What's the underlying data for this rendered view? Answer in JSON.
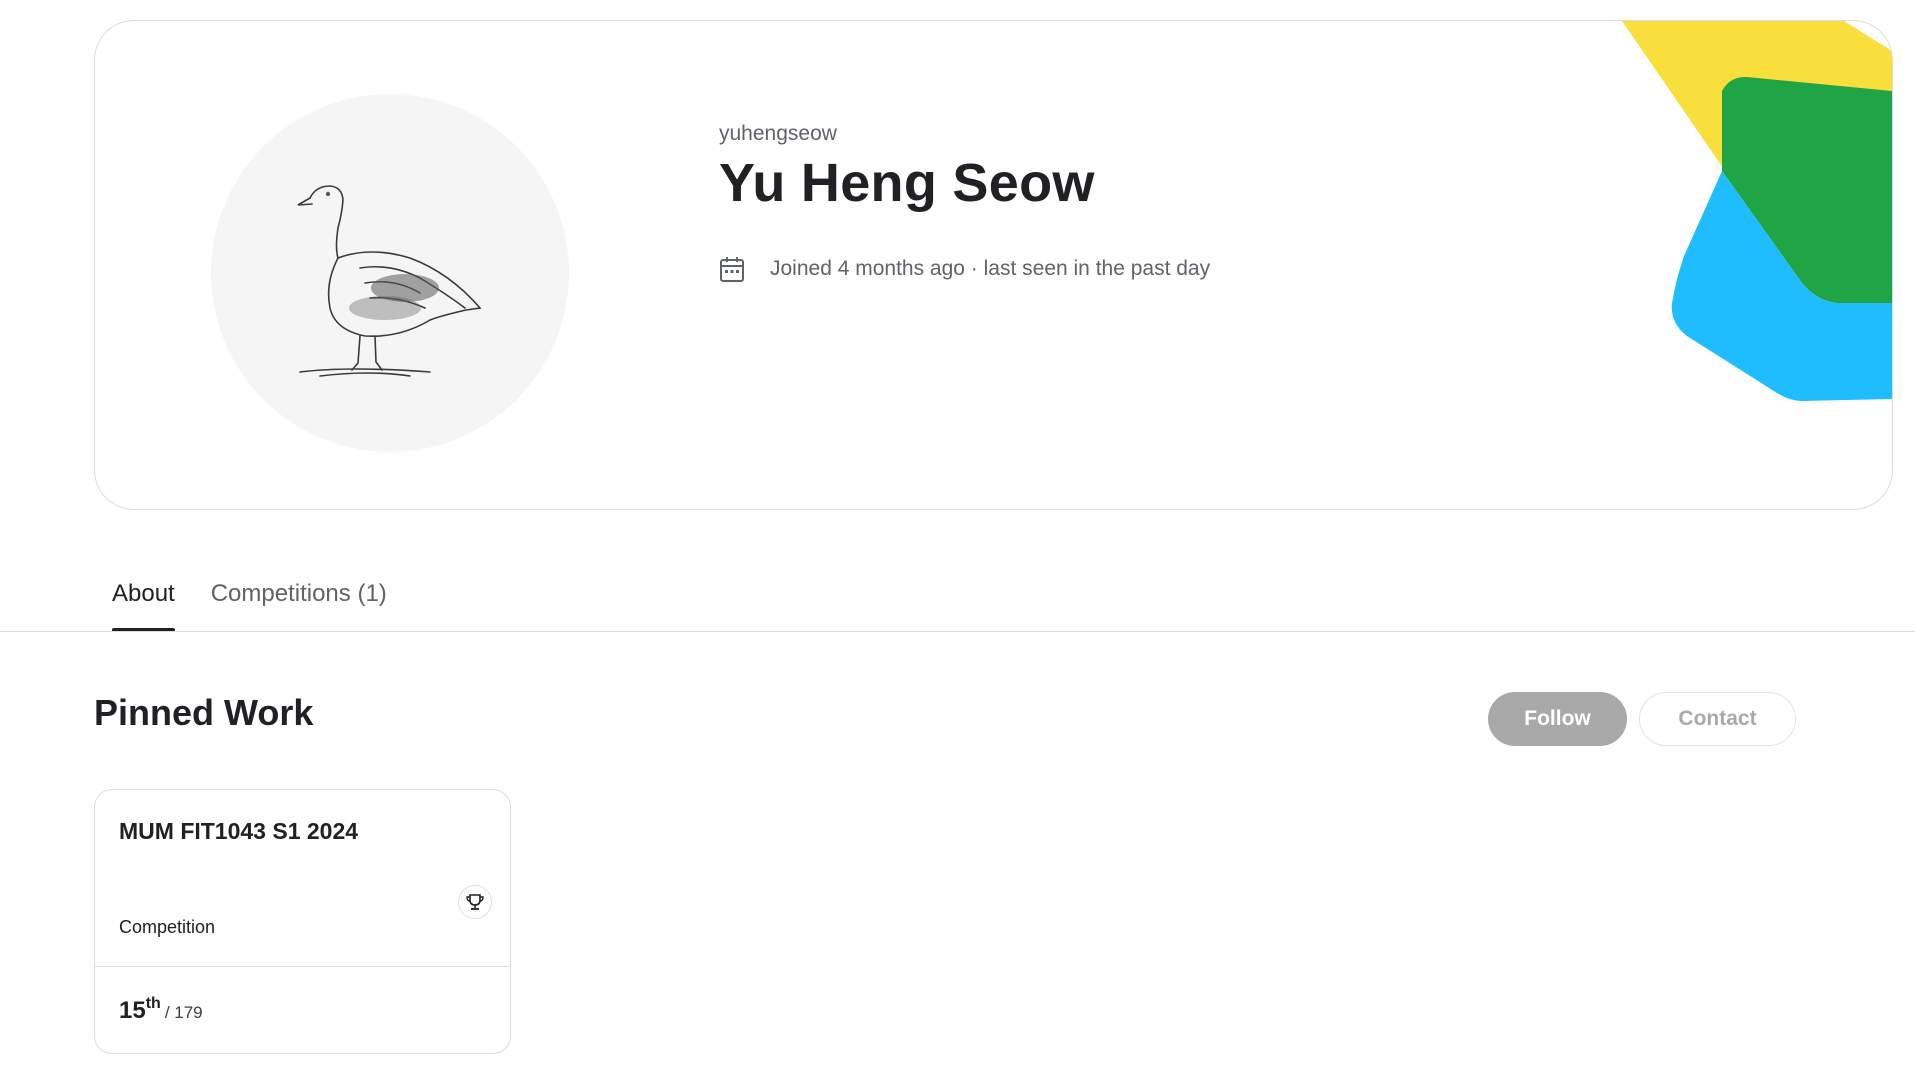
{
  "profile": {
    "username": "yuhengseow",
    "display_name": "Yu Heng Seow",
    "meta": "Joined 4 months ago · last seen in the past day",
    "avatar_icon": "goose-illustration",
    "decor_colors": [
      "#f9df3c",
      "#20a546",
      "#1fbdfd"
    ]
  },
  "tabs": [
    {
      "label": "About",
      "active": true
    },
    {
      "label": "Competitions (1)",
      "active": false
    }
  ],
  "pinned": {
    "title": "Pinned Work",
    "follow_label": "Follow",
    "contact_label": "Contact"
  },
  "competition_card": {
    "title": "MUM FIT1043 S1 2024",
    "type": "Competition",
    "rank": "15",
    "rank_suffix": "th",
    "total": "/ 179",
    "thumb_icon": "soundwave-icon",
    "badge_icon": "trophy-icon"
  }
}
